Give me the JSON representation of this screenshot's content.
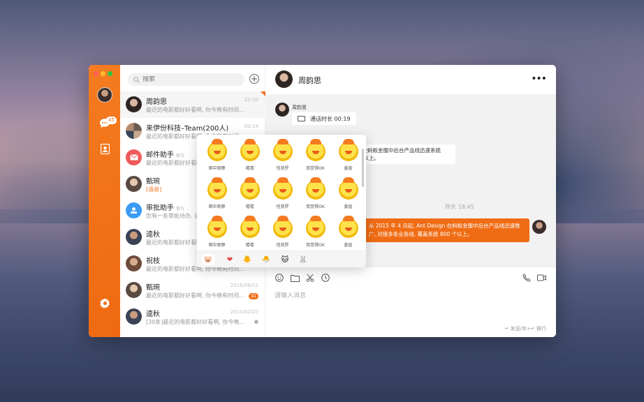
{
  "window_controls": [
    "close",
    "minimize",
    "maximize"
  ],
  "rail": {
    "chat_badge": "45",
    "icons": [
      "avatar",
      "chat-icon",
      "contacts-icon",
      "settings-icon"
    ]
  },
  "search": {
    "placeholder": "搜索"
  },
  "conversations": [
    {
      "name": "周韵思",
      "tag": "",
      "preview": "最近的电影都好好看啊, 你今晚有时间…",
      "time": "22:00",
      "badge": "",
      "active": true,
      "pinned": true
    },
    {
      "name": "来伊份科技–Team(200人)",
      "tag": "",
      "preview": "最近的电影都好好看啊, 你今晚有时间…",
      "time": "00:14",
      "badge": "",
      "active": false,
      "pinned": false
    },
    {
      "name": "邮件助手",
      "tag": "官方",
      "preview": "最近的电影都好好看啊, 你今晚有时间…",
      "time": "",
      "badge": "",
      "active": false,
      "pinned": false
    },
    {
      "name": "甄琬",
      "tag": "",
      "preview": "[语音]",
      "time": "",
      "badge": "",
      "active": false,
      "pinned": false
    },
    {
      "name": "审批助手",
      "tag": "官方",
      "preview": "您有一条审批待办, 请…",
      "time": "",
      "badge": "",
      "active": false,
      "pinned": false
    },
    {
      "name": "逵秋",
      "tag": "",
      "preview": "最近的电影都好好看啊, 你今晚有时间…",
      "time": "",
      "badge": "",
      "active": false,
      "pinned": false
    },
    {
      "name": "祝枝",
      "tag": "",
      "preview": "最近的电影都好好看啊, 你今晚有时间…",
      "time": "",
      "badge": "",
      "active": false,
      "pinned": false
    },
    {
      "name": "甄琬",
      "tag": "",
      "preview": "最近的电影都好好看啊, 你今晚有时间…",
      "time": "2016/06/01",
      "badge": "41",
      "active": false,
      "pinned": false
    },
    {
      "name": "逵秋",
      "tag": "",
      "preview": "[30条]最近的电影都好好看啊, 你今晚…",
      "time": "2014/02/20",
      "badge": "",
      "active": false,
      "pinned": false
    }
  ],
  "chat": {
    "title": "周韵思",
    "more_label": "•••",
    "sender": "周韵思",
    "call_text": "通话时长 00:19",
    "left_message": "esign 在蚂蚁金服中后台产品线迅速系统 800 个以上。",
    "timestamp": "昨天 18:45",
    "right_message": "从 2015 年 4 月起, Ant Design 在蚂蚁金服中后台产品线迅速推广, 对接多条业务线, 覆盖系统 800 个以上。",
    "input_placeholder": "请输入消息",
    "send_hint": "↵ 发送/⌘+↵ 换行"
  },
  "emoji_panel": {
    "stickers": [
      "暗中观察",
      "嘻嘻",
      "怪我罗",
      "我觉得OK",
      "委屈",
      "暗中观察",
      "嘻嘻",
      "怪我罗",
      "我觉得OK",
      "委屈",
      "暗中观察",
      "嘻嘻",
      "怪我罗",
      "我觉得OK",
      "委屈"
    ],
    "tabs": [
      "🐷",
      "❤",
      "🐥",
      "🐣",
      "🐱",
      "🐰"
    ]
  },
  "colors": {
    "accent": "#f07020",
    "rail": "#f47b20",
    "bubble_self": "#f06c14"
  }
}
